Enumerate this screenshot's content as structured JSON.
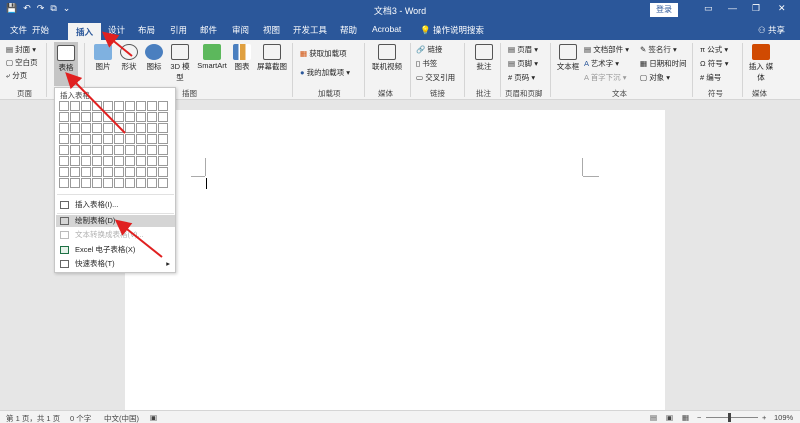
{
  "window": {
    "title": "文档3 - Word",
    "login": "登录",
    "minimize": "—",
    "restore": "❐",
    "close": "✕"
  },
  "tabs": [
    "文件",
    "开始",
    "插入",
    "设计",
    "布局",
    "引用",
    "邮件",
    "审阅",
    "视图",
    "开发工具",
    "帮助",
    "Acrobat"
  ],
  "active_tab": "插入",
  "tell_me": "操作说明搜索",
  "share": "共享",
  "ribbon": {
    "pages": {
      "cover": "封面",
      "blank": "空白页",
      "break": "分页",
      "label": "页面"
    },
    "tables": {
      "table": "表格",
      "label": "表格"
    },
    "illustrations": {
      "picture": "图片",
      "shapes": "形状",
      "icons": "图标",
      "model3d": "3D 模型",
      "smartart": "SmartArt",
      "chart": "图表",
      "screenshot": "屏幕截图",
      "label": "插图"
    },
    "addins": {
      "get": "获取加载项",
      "mine": "我的加载项",
      "label": "加载项"
    },
    "media": {
      "video": "联机视频",
      "label": "媒体"
    },
    "links": {
      "link": "链接",
      "bookmark": "书签",
      "crossref": "交叉引用",
      "label": "链接"
    },
    "comments": {
      "comment": "批注",
      "label": "批注"
    },
    "headerfooter": {
      "header": "页眉",
      "footer": "页脚",
      "pagenum": "页码",
      "label": "页眉和页脚"
    },
    "text": {
      "textbox": "文本框",
      "quickparts": "文档部件",
      "wordart": "艺术字",
      "dropcap": "首字下沉",
      "signature": "签名行",
      "datetime": "日期和时间",
      "object": "对象",
      "label": "文本"
    },
    "symbols": {
      "equation": "公式",
      "symbol": "符号",
      "number": "编号",
      "label": "符号"
    },
    "embed": {
      "media": "插入 媒体",
      "label": "媒体"
    }
  },
  "dropdown": {
    "header": "插入表格",
    "items": [
      {
        "label": "插入表格(I)...",
        "disabled": false
      },
      {
        "label": "绘制表格(D)",
        "disabled": false
      },
      {
        "label": "文本转换成表格(V)...",
        "disabled": true
      },
      {
        "label": "Excel 电子表格(X)",
        "disabled": false
      },
      {
        "label": "快速表格(T)",
        "disabled": false
      }
    ]
  },
  "status": {
    "page": "第 1 页，共 1 页",
    "words": "0 个字",
    "language": "中文(中国)",
    "zoom": "109%"
  },
  "colors": {
    "brand": "#2b579a",
    "arrow": "#e02020"
  }
}
